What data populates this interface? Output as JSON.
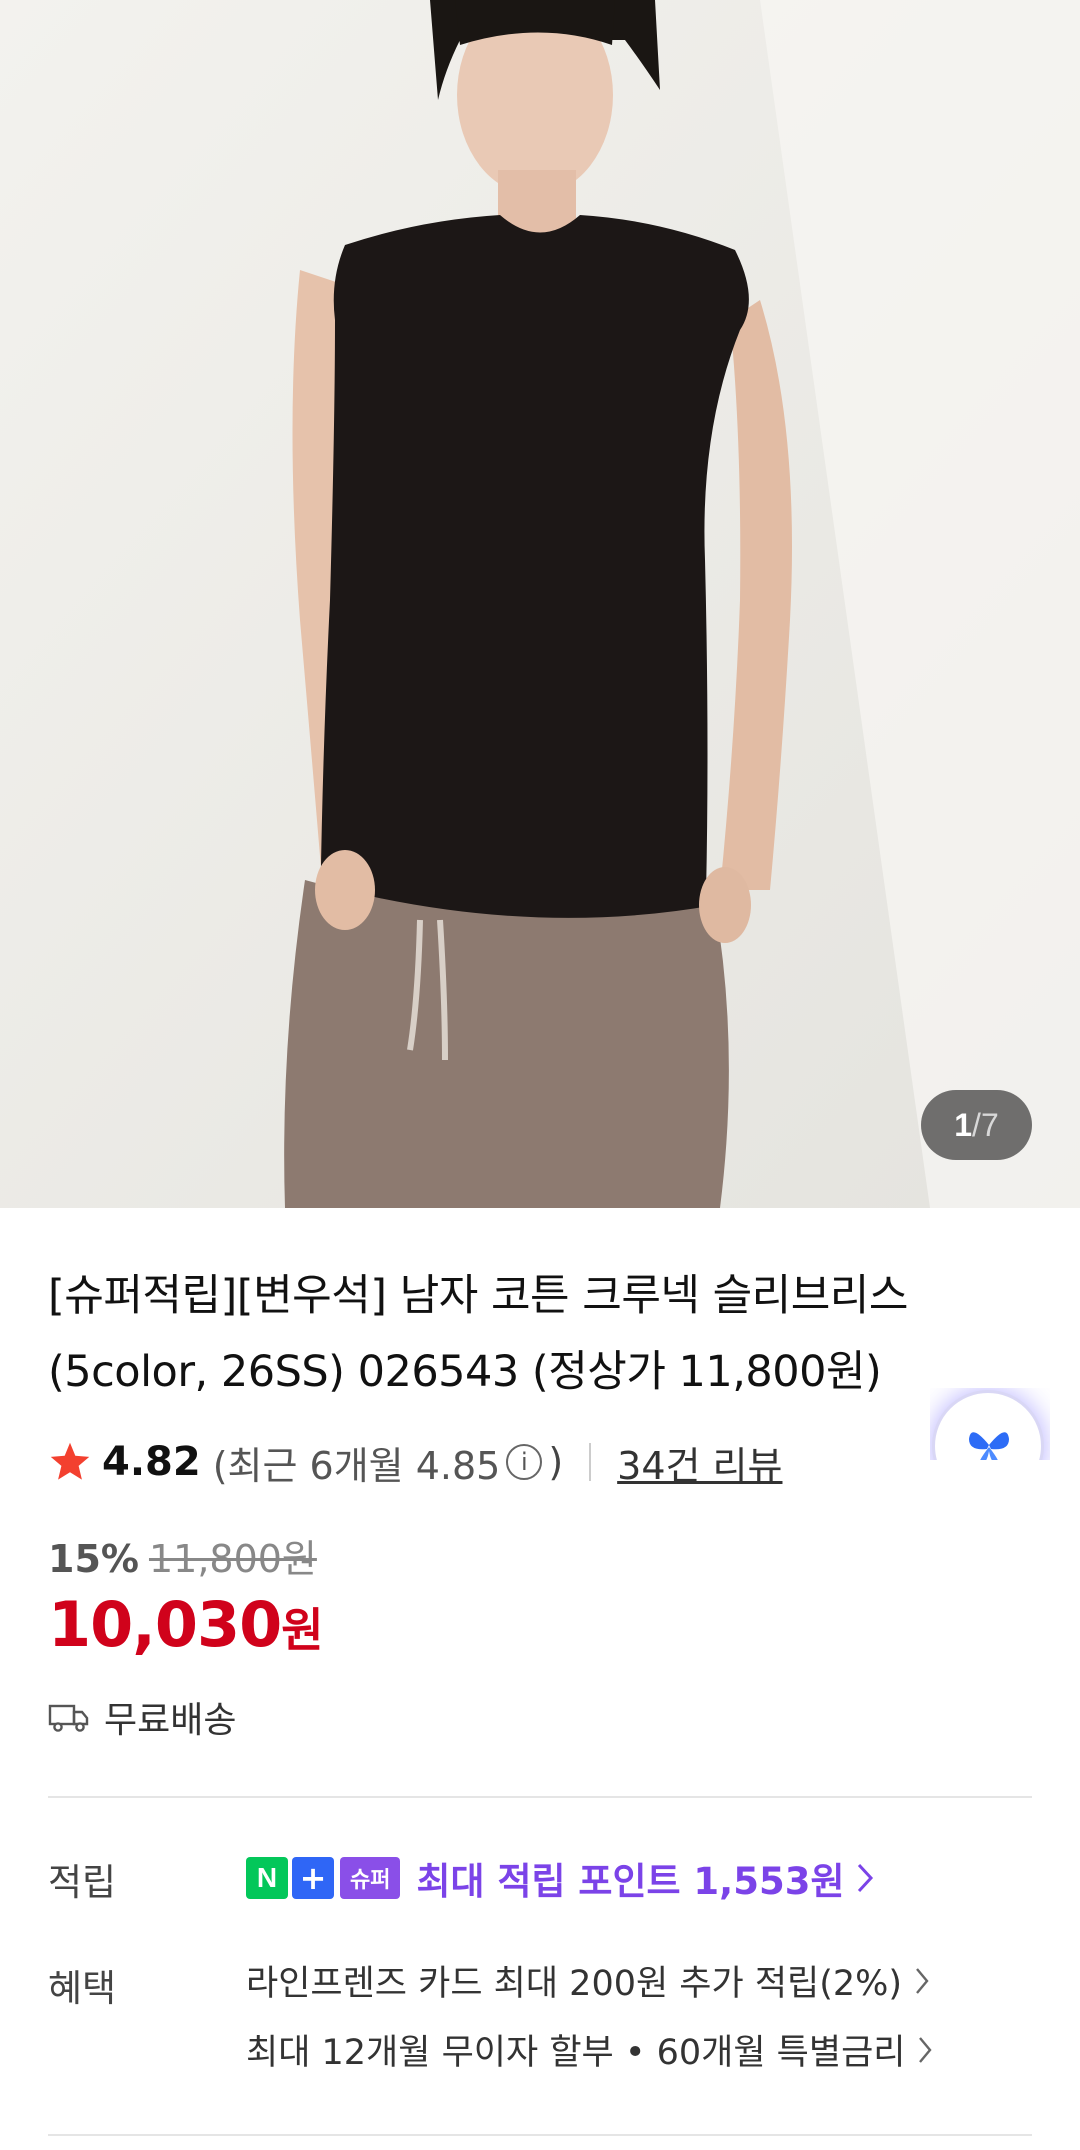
{
  "gallery": {
    "current": "1",
    "separator": "/",
    "total": "7"
  },
  "product": {
    "title_line1": "[슈퍼적립][변우석] 남자 코튼 크루넥 슬리브리스",
    "title_line2": "(5color, 26SS) 026543 (정상가 11,800원)"
  },
  "rating": {
    "score": "4.82",
    "recent": "(최근 6개월 4.85",
    "recent_close": ")",
    "info_symbol": "i",
    "reviews": "34건 리뷰"
  },
  "price": {
    "discount": "15%",
    "original": "11,800원",
    "current": "10,030",
    "unit": "원"
  },
  "shipping": {
    "label": "무료배송"
  },
  "points": {
    "label": "적립",
    "badge_n": "N",
    "badge_plus": "+",
    "badge_super": "슈퍼",
    "text": "최대 적립 포인트 1,553원"
  },
  "benefits": {
    "label": "혜택",
    "items": [
      "라인프렌즈 카드 최대 200원 추가 적립(2%)",
      "최대 12개월 무이자 할부 • 60개월 특별금리"
    ]
  },
  "colors": {
    "price_red": "#d0021b",
    "accent_purple": "#7b43e8",
    "naver_green": "#03c75a"
  }
}
